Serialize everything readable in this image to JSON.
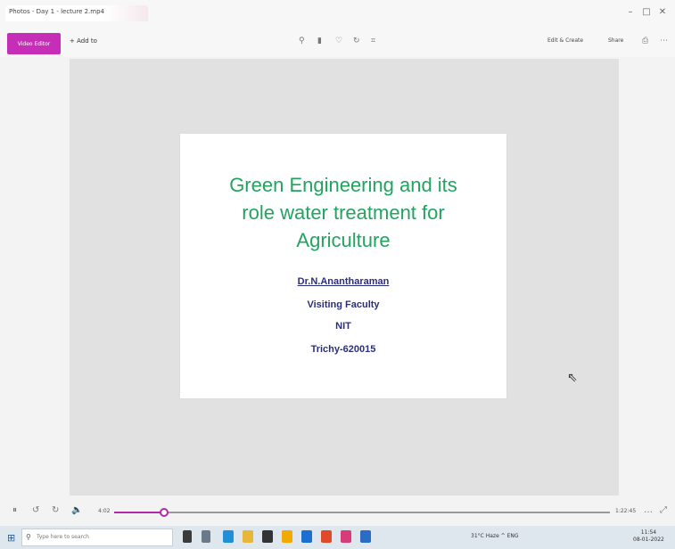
{
  "window": {
    "title": "Photos - Day 1 - lecture 2.mp4",
    "minimize": "–",
    "maximize": "□",
    "close": "✕"
  },
  "toolbar": {
    "app_button_label": "Video Editor",
    "add_label": "+ Add to",
    "right_label_1": "Edit & Create",
    "right_label_2": "Share",
    "icons": [
      "zoom-icon",
      "delete-icon",
      "favorite-icon",
      "rotate-icon",
      "crop-icon"
    ]
  },
  "slide": {
    "title_lines": [
      "Green Engineering and its",
      "role water treatment for",
      "Agriculture"
    ],
    "author": "Dr.N.Anantharaman",
    "position": "Visiting Faculty",
    "institute": "NIT",
    "place": "Trichy-620015"
  },
  "player": {
    "time_current": "4:02",
    "time_total": "1:22:45",
    "progress_fraction": 0.1
  },
  "taskbar": {
    "search_placeholder": "Type here to search",
    "tray_text": "31°C Haze  ^  ENG",
    "clock_time": "11:54",
    "clock_date": "08-01-2022"
  },
  "colors": {
    "accent": "#c72eb8",
    "slide_title": "#23a360",
    "slide_text": "#2b2f7a"
  }
}
